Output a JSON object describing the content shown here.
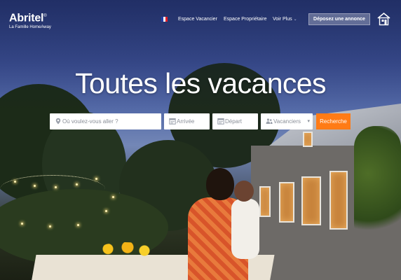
{
  "header": {
    "logo": {
      "name": "Abritel",
      "mark": "®",
      "tagline": "La Famille HomeAway"
    },
    "language_flag_colors": [
      "#1f3ea6",
      "#ffffff",
      "#e1202a"
    ],
    "nav": [
      {
        "label": "Espace Vacancier"
      },
      {
        "label": "Espace Propriétaire"
      },
      {
        "label": "Voir Plus",
        "dropdown": true
      }
    ],
    "cta_label": "Déposez une annonce",
    "home_icon": "house-icon"
  },
  "hero": {
    "title": "Toutes les vacances"
  },
  "search": {
    "destination_placeholder": "Où voulez-vous aller ?",
    "arrival_label": "Arrivée",
    "departure_label": "Départ",
    "travelers_label": "Vacanciers",
    "button_label": "Recherche",
    "icons": [
      "location-pin-icon",
      "calendar-icon",
      "calendar-icon",
      "people-icon"
    ],
    "button_color": "#ff7b16"
  }
}
